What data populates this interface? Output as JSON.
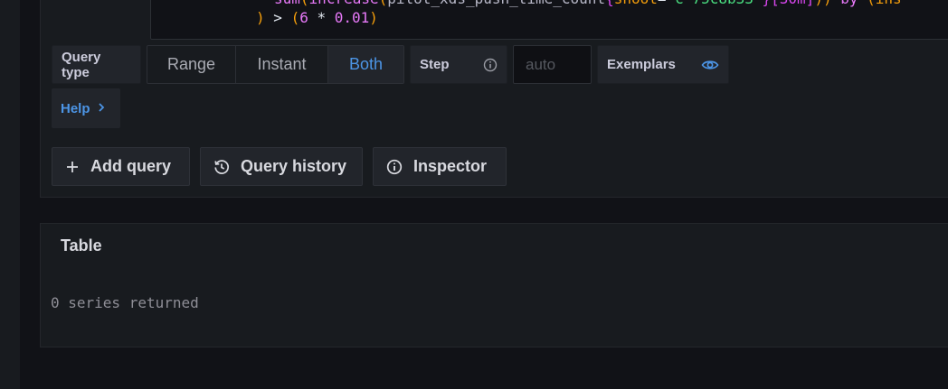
{
  "editor": {
    "line1": {
      "fn1": "sum",
      "p1": "(",
      "fn2": "increase",
      "p2": "(",
      "metric": "pilot_xds_push_time_count",
      "b1": "{",
      "label": "shoot",
      "eq": "=",
      "value": "\"c-75c8b33\"",
      "b2": "}",
      "range": "[30m]",
      "p3": "))",
      "kw": "by",
      "p4": "(",
      "grp": "ins"
    },
    "line2": {
      "close": ")",
      "op": ">",
      "p1": "(",
      "n1": "6",
      "star": "*",
      "n2": "0.01",
      "p2": ")"
    }
  },
  "options": {
    "query_type_label": "Query type",
    "query_types": [
      "Range",
      "Instant",
      "Both"
    ],
    "selected_query_type": "Both",
    "step_label": "Step",
    "step_placeholder": "auto",
    "exemplars_label": "Exemplars"
  },
  "help": {
    "label": "Help"
  },
  "actions": {
    "add_query": "Add query",
    "query_history": "Query history",
    "inspector": "Inspector"
  },
  "table": {
    "title": "Table",
    "empty_message": "0 series returned"
  },
  "colors": {
    "accent": "#4c95e6",
    "panel": "#181b1f",
    "background": "#111217"
  },
  "icons": {
    "step_info": "info-icon",
    "exemplars": "eye-icon",
    "help_chevron": "chevron-right-icon",
    "add": "plus-icon",
    "history": "history-icon",
    "inspector": "info-icon"
  }
}
